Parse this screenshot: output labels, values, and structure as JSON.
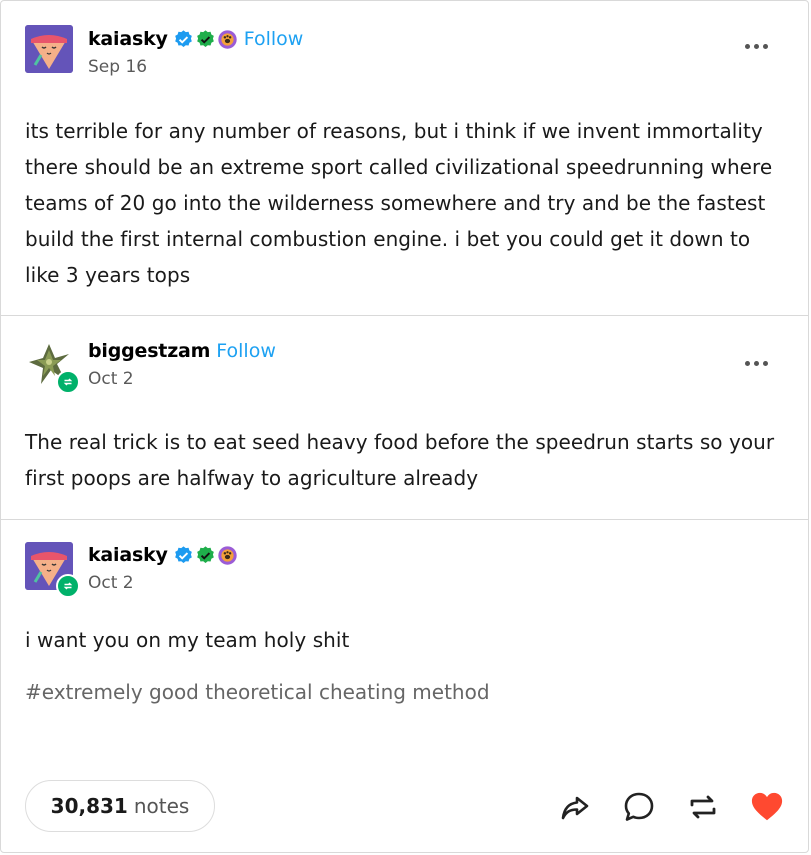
{
  "posts": [
    {
      "username": "kaiasky",
      "follow_label": "Follow",
      "date": "Sep 16",
      "text": "its terrible for any number of reasons, but i think if we invent immortality there should be an extreme sport called civilizational speedrunning where teams of 20 go into the wilderness somewhere and try and be the fastest build the first internal combustion engine. i bet you could get it down to like 3 years tops"
    },
    {
      "username": "biggestzam",
      "follow_label": "Follow",
      "date": "Oct 2",
      "text": "The real trick is to eat seed heavy food before the speedrun starts so your first poops are halfway to agriculture already"
    },
    {
      "username": "kaiasky",
      "date": "Oct 2",
      "text": "i want you on my team holy shit"
    }
  ],
  "tags": "#extremely good theoretical cheating method",
  "footer": {
    "notes_count": "30,831",
    "notes_label": "notes"
  },
  "icons": {
    "verified": "blue-check-badge",
    "green": "green-check-badge",
    "paw": "paw-badge",
    "share": "share-icon",
    "reply": "reply-icon",
    "reblog": "reblog-icon",
    "like": "heart-icon"
  },
  "colors": {
    "follow": "#1da1f2",
    "reblog_badge": "#00b16a",
    "heart": "#ff4930"
  }
}
